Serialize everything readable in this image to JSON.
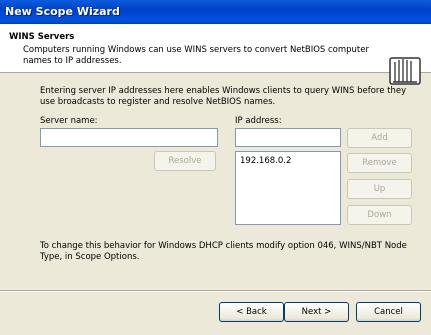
{
  "window": {
    "title": "New Scope Wizard"
  },
  "header": {
    "title": "WINS Servers",
    "subtitle": "Computers running Windows can use WINS servers to convert NetBIOS computer names to IP addresses."
  },
  "intro_text": "Entering server IP addresses here enables Windows clients to query WINS before they use broadcasts to register and resolve NetBIOS names.",
  "server_name": {
    "label": "Server name:",
    "value": ""
  },
  "ip_address": {
    "label": "IP address:",
    "value": ""
  },
  "buttons": {
    "resolve": "Resolve",
    "add": "Add",
    "remove": "Remove",
    "up": "Up",
    "down": "Down",
    "back": "< Back",
    "next": "Next >",
    "cancel": "Cancel"
  },
  "wins_list": [
    "192.168.0.2"
  ],
  "note_text": "To change this behavior for Windows DHCP clients modify option 046, WINS/NBT Node Type, in Scope Options."
}
